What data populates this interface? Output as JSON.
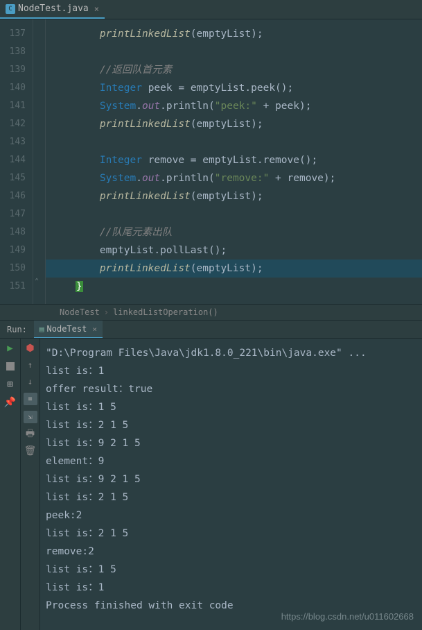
{
  "tab": {
    "filename": "NodeTest.java",
    "icon_letter": "C"
  },
  "gutter": {
    "start": 137,
    "end": 151
  },
  "code": {
    "l137": {
      "method": "printLinkedList",
      "arg": "emptyList"
    },
    "l139": {
      "comment": "//返回队首元素"
    },
    "l140": {
      "type": "Integer",
      "var": "peek",
      "obj": "emptyList",
      "call": "peek"
    },
    "l141": {
      "cls": "System",
      "field": "out",
      "method": "println",
      "str": "\"peek:\"",
      "var": "peek"
    },
    "l142": {
      "method": "printLinkedList",
      "arg": "emptyList"
    },
    "l144": {
      "type": "Integer",
      "var": "remove",
      "obj": "emptyList",
      "call": "remove"
    },
    "l145": {
      "cls": "System",
      "field": "out",
      "method": "println",
      "str": "\"remove:\"",
      "var": "remove"
    },
    "l146": {
      "method": "printLinkedList",
      "arg": "emptyList"
    },
    "l148": {
      "comment": "//队尾元素出队"
    },
    "l149": {
      "obj": "emptyList",
      "call": "pollLast"
    },
    "l150": {
      "method": "printLinkedList",
      "arg": "emptyList"
    },
    "l151": {
      "brace": "}"
    }
  },
  "breadcrumb": {
    "class": "NodeTest",
    "method": "linkedListOperation()"
  },
  "run": {
    "label": "Run:",
    "config": "NodeTest"
  },
  "console": {
    "lines": [
      "\"D:\\Program Files\\Java\\jdk1.8.0_221\\bin\\java.exe\" ...",
      "list is：1",
      "offer result：true",
      "list is：1 5",
      "list is：2 1 5",
      "list is：9 2 1 5",
      "element：9",
      "list is：9 2 1 5",
      "list is：2 1 5",
      "peek:2",
      "list is：2 1 5",
      "remove:2",
      "list is：1 5",
      "list is：1",
      "",
      "Process finished with exit code"
    ]
  },
  "watermark": "https://blog.csdn.net/u011602668"
}
